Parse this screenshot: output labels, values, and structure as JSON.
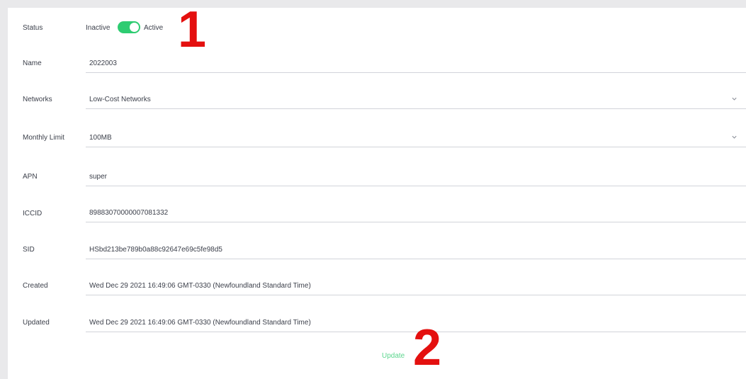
{
  "form": {
    "status": {
      "label": "Status",
      "off_text": "Inactive",
      "on_text": "Active",
      "is_active": true
    },
    "name": {
      "label": "Name",
      "value": "2022003"
    },
    "networks": {
      "label": "Networks",
      "value": "Low-Cost Networks"
    },
    "monthly_limit": {
      "label": "Monthly Limit",
      "value": "100MB"
    },
    "apn": {
      "label": "APN",
      "value": "super"
    },
    "iccid": {
      "label": "ICCID",
      "value": "89883070000007081332"
    },
    "sid": {
      "label": "SID",
      "value": "HSbd213be789b0a88c92647e69c5fe98d5"
    },
    "created": {
      "label": "Created",
      "value": "Wed Dec 29 2021 16:49:06 GMT-0330 (Newfoundland Standard Time)"
    },
    "updated": {
      "label": "Updated",
      "value": "Wed Dec 29 2021 16:49:06 GMT-0330 (Newfoundland Standard Time)"
    },
    "update_button": "Update"
  },
  "annotations": {
    "marker_1": "1",
    "marker_2": "2"
  },
  "colors": {
    "toggle_on": "#2ecc71",
    "update_text": "#5cd68e",
    "annotation": "#e4100f",
    "background": "#e9e9eb"
  },
  "icons": [
    "chevron-down-icon"
  ]
}
